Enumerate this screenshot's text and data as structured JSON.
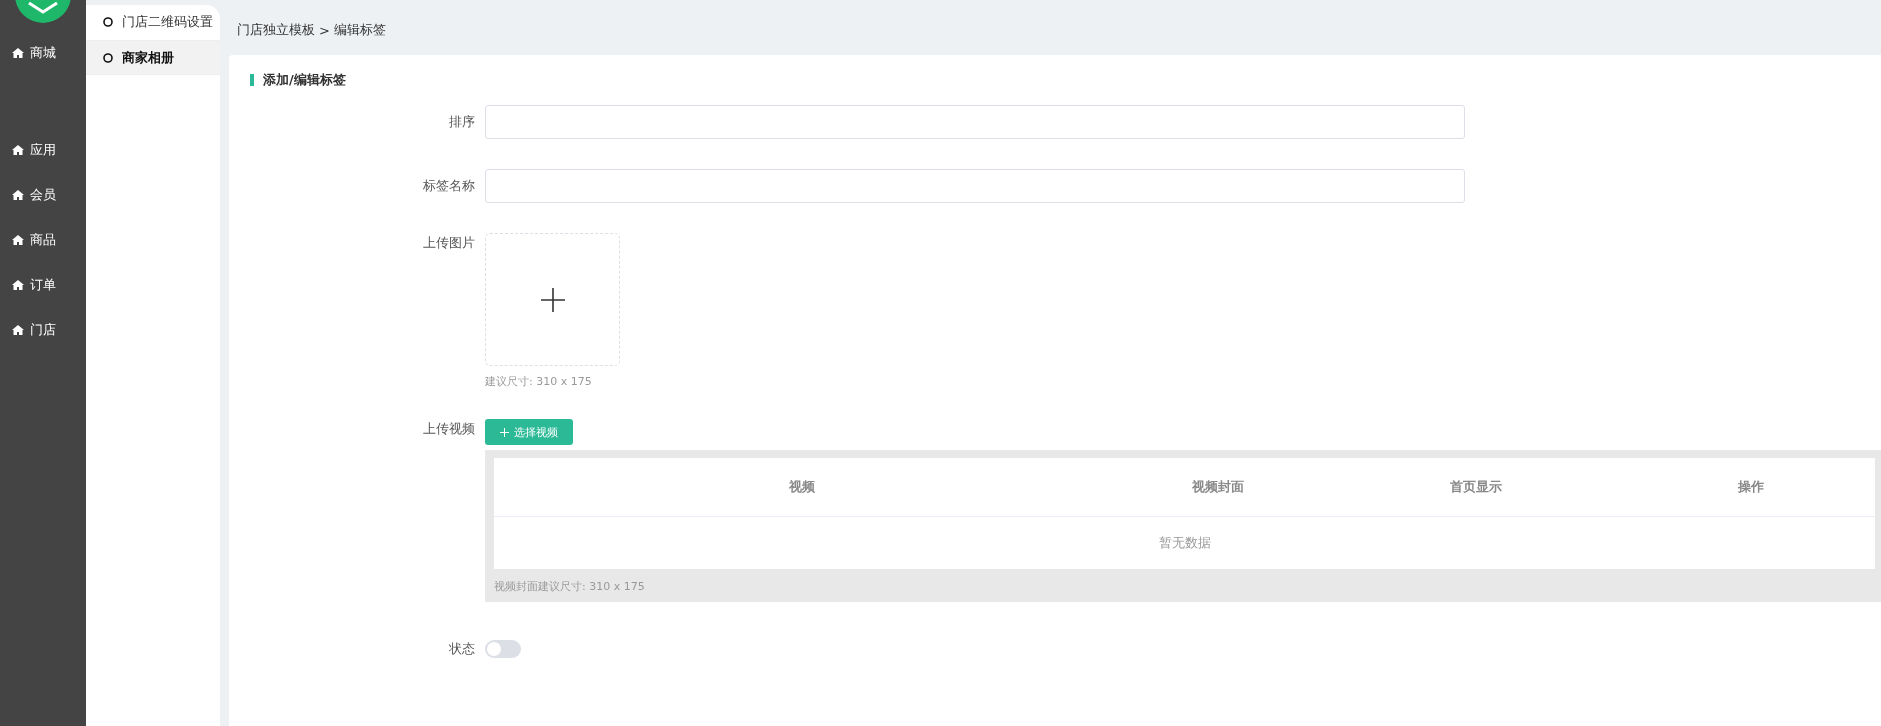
{
  "sidebar": {
    "items": [
      {
        "label": "商城"
      },
      {
        "label": "应用"
      },
      {
        "label": "会员"
      },
      {
        "label": "商品"
      },
      {
        "label": "订单"
      },
      {
        "label": "门店"
      }
    ]
  },
  "submenu": {
    "items": [
      {
        "label": "门店二维码设置",
        "selected": false
      },
      {
        "label": "商家相册",
        "selected": true
      }
    ]
  },
  "breadcrumb": {
    "parent": "门店独立模板",
    "separator": ">",
    "current": "编辑标签"
  },
  "form": {
    "title": "添加/编辑标签",
    "fields": [
      {
        "kind": "text",
        "label": "排序"
      },
      {
        "kind": "text",
        "label": "标签名称"
      },
      {
        "kind": "image",
        "label": "上传图片",
        "hint": "建议尺寸: 310 x 175"
      },
      {
        "kind": "video",
        "label": "上传视频",
        "button": "选择视频",
        "columns": [
          "视频",
          "视频封面",
          "首页显示",
          "操作"
        ],
        "empty_text": "暂无数据",
        "note": "视频封面建议尺寸: 310 x 175"
      },
      {
        "kind": "switch",
        "label": "状态",
        "on": false
      }
    ]
  }
}
